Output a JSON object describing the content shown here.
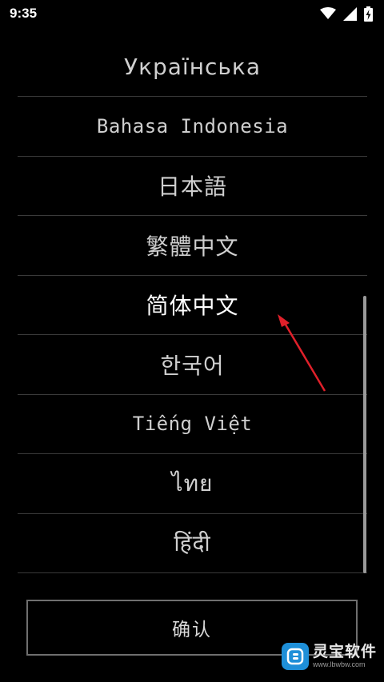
{
  "status_bar": {
    "time": "9:35"
  },
  "languages": [
    {
      "label": "Українська"
    },
    {
      "label": "Bahasa Indonesia"
    },
    {
      "label": "日本語"
    },
    {
      "label": "繁體中文"
    },
    {
      "label": "简体中文",
      "selected": true
    },
    {
      "label": "한국어"
    },
    {
      "label": "Tiếng Việt"
    },
    {
      "label": "ไทย"
    },
    {
      "label": "हिंदी"
    }
  ],
  "confirm_button": {
    "label": "确认"
  },
  "watermark": {
    "title": "灵宝软件",
    "subtitle": "www.lbwbw.com"
  },
  "colors": {
    "background": "#000000",
    "annotation_arrow": "#e0202a",
    "logo": "#1e8fd8"
  }
}
